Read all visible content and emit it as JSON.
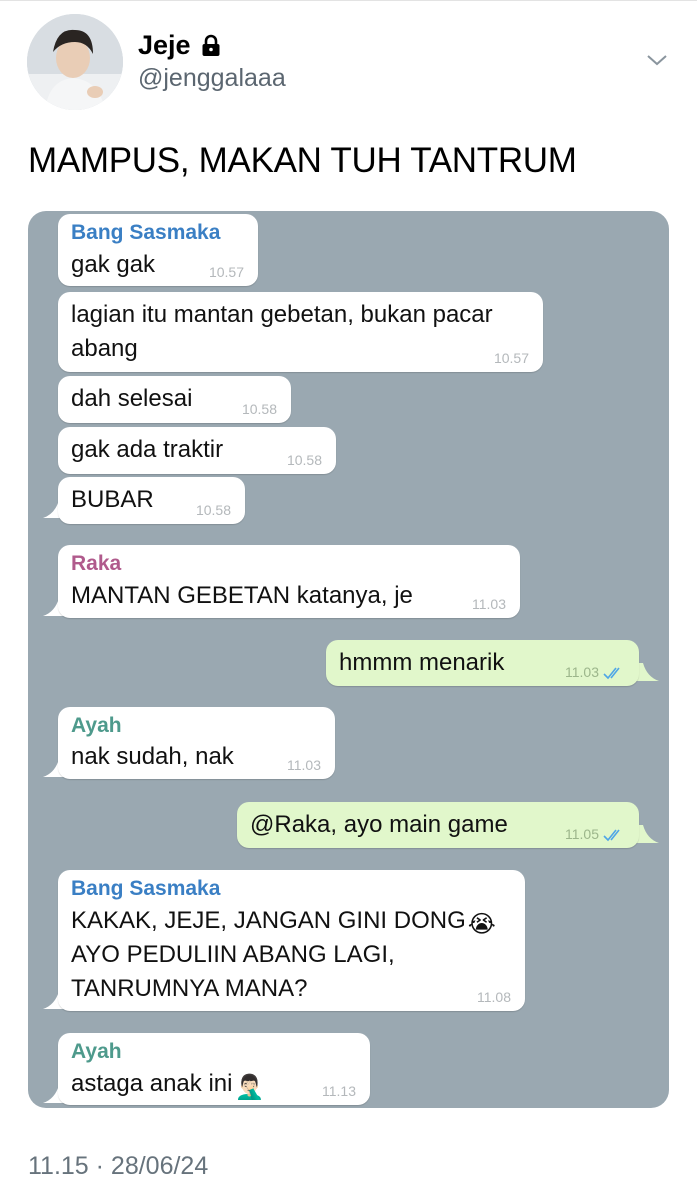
{
  "author": {
    "name": "Jeje",
    "handle": "@jenggalaaa"
  },
  "tweet": {
    "text": "MAMPUS, MAKAN TUH TANTRUM",
    "timestamp": "11.15 · 28/06/24"
  },
  "icons": {
    "lock": "lock-icon",
    "menu": "chevron-down-icon",
    "read": "double-check-icon"
  },
  "colors": {
    "chat_bg": "#9aa8b1",
    "incoming_bubble": "#ffffff",
    "outgoing_bubble": "#e1f7cb",
    "sender_bang_sasmaka": "#3a7fc4",
    "sender_raka": "#b05a8c",
    "sender_ayah": "#4e9a8c",
    "read_ticks": "#4fa6e6"
  },
  "chat": {
    "messages": [
      {
        "sender": "Bang Sasmaka",
        "lines": [
          "gak gak"
        ],
        "time": "10.57"
      },
      {
        "lines": [
          "lagian itu mantan gebetan, bukan pacar",
          "abang"
        ],
        "time": "10.57"
      },
      {
        "lines": [
          "dah selesai"
        ],
        "time": "10.58"
      },
      {
        "lines": [
          "gak ada traktir"
        ],
        "time": "10.58"
      },
      {
        "lines": [
          "BUBAR"
        ],
        "time": "10.58"
      },
      {
        "sender": "Raka",
        "lines": [
          "MANTAN GEBETAN katanya, je"
        ],
        "time": "11.03"
      },
      {
        "outgoing": true,
        "lines": [
          "hmmm menarik"
        ],
        "time": "11.03"
      },
      {
        "sender": "Ayah",
        "lines": [
          "nak sudah, nak"
        ],
        "time": "11.03"
      },
      {
        "outgoing": true,
        "lines": [
          "@Raka, ayo main game"
        ],
        "time": "11.05"
      },
      {
        "sender": "Bang Sasmaka",
        "lines": [
          "KAKAK, JEJE, JANGAN GINI DONG",
          "AYO PEDULIIN ABANG LAGI,",
          "TANRUMNYA MANA?"
        ],
        "emoji": "😭",
        "time": "11.08"
      },
      {
        "sender": "Ayah",
        "lines": [
          "astaga anak ini"
        ],
        "emoji": "🤦🏻‍♂️",
        "time": "11.13"
      }
    ]
  }
}
